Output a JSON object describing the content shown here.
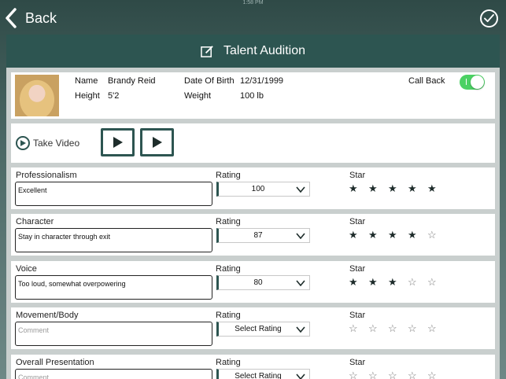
{
  "status": {
    "time": "1:58 PM"
  },
  "nav": {
    "back_label": "Back"
  },
  "header": {
    "title": "Talent Audition"
  },
  "profile": {
    "name_label": "Name",
    "name": "Brandy Reid",
    "height_label": "Height",
    "height": "5'2",
    "dob_label": "Date Of Birth",
    "dob": "12/31/1999",
    "weight_label": "Weight",
    "weight": "100 lb",
    "callback_label": "Call Back",
    "callback_on": true,
    "toggle_color": "#4bd163"
  },
  "video": {
    "take_video_label": "Take Video"
  },
  "labels": {
    "rating": "Rating",
    "star": "Star"
  },
  "criteria": [
    {
      "name": "Professionalism",
      "comment": "Excellent",
      "comment_placeholder": "Comment",
      "rating": "100",
      "stars": 5
    },
    {
      "name": "Character",
      "comment": "Stay in character through exit",
      "comment_placeholder": "Comment",
      "rating": "87",
      "stars": 4
    },
    {
      "name": "Voice",
      "comment": "Too loud, somewhat overpowering",
      "comment_placeholder": "Comment",
      "rating": "80",
      "stars": 3
    },
    {
      "name": "Movement/Body",
      "comment": "",
      "comment_placeholder": "Comment",
      "rating": "Select Rating",
      "stars": 0
    },
    {
      "name": "Overall Presentation",
      "comment": "",
      "comment_placeholder": "Comment",
      "rating": "Select Rating",
      "stars": 0
    }
  ],
  "colors": {
    "accent": "#2d5551",
    "panel_bg": "#c9cfce"
  }
}
